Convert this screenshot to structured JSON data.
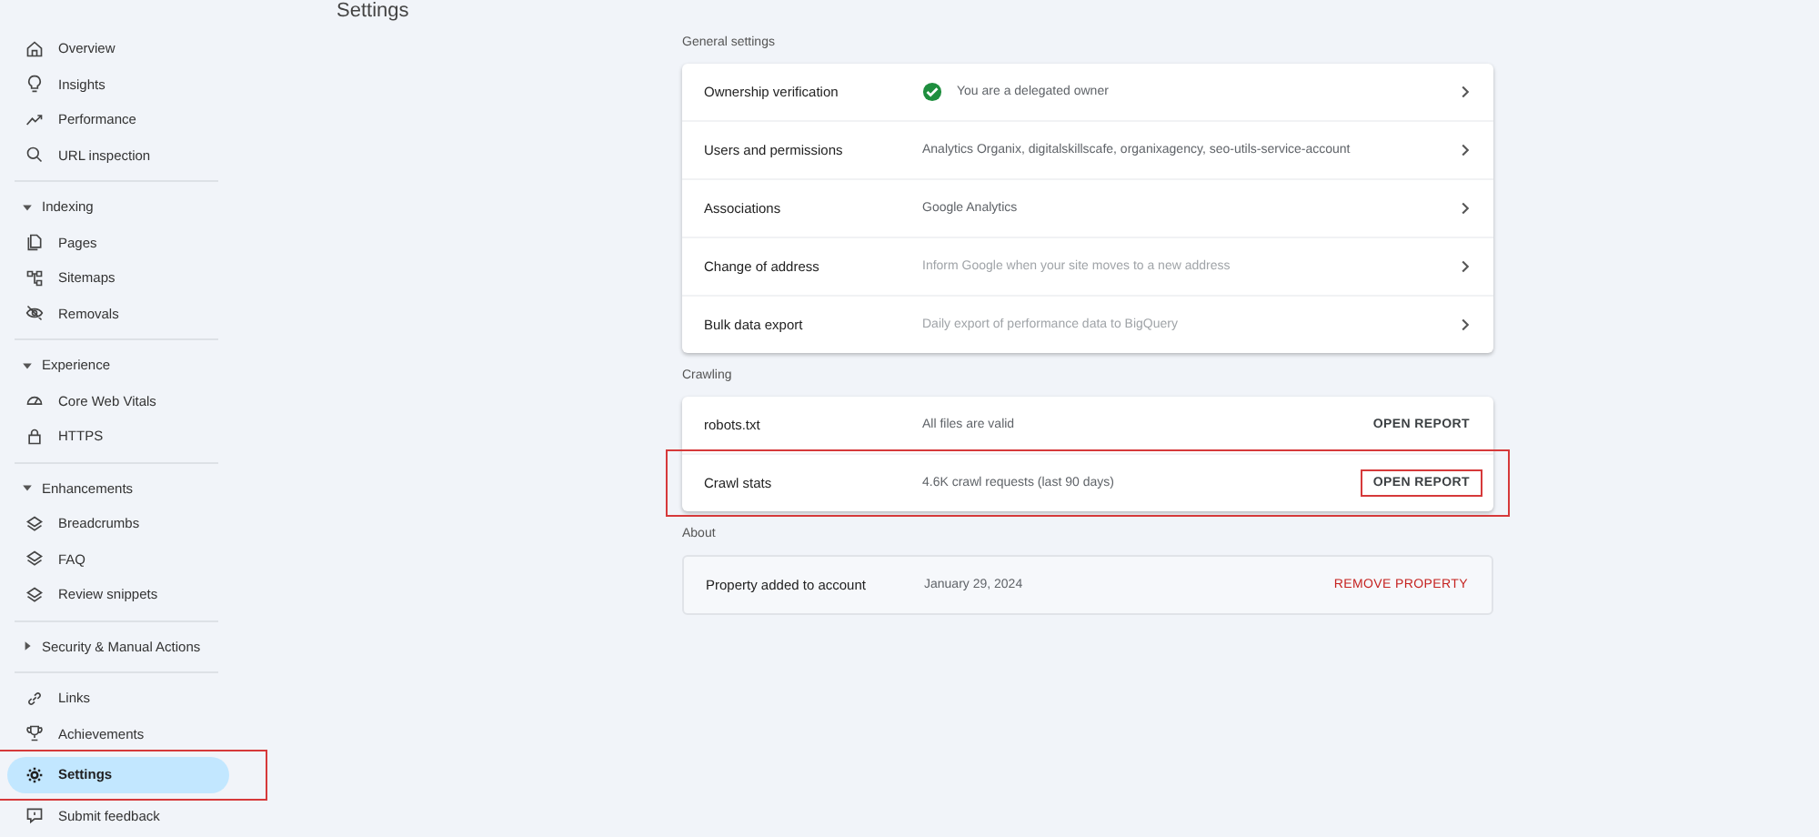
{
  "header": {
    "title": "Settings"
  },
  "sidebar": {
    "groups": [
      {
        "items": [
          {
            "label": "Overview",
            "selected": false,
            "highlighted": false
          },
          {
            "label": "Insights",
            "selected": false,
            "highlighted": false
          },
          {
            "label": "Performance",
            "selected": false,
            "highlighted": false
          },
          {
            "label": "URL inspection",
            "selected": false,
            "highlighted": false
          }
        ]
      },
      {
        "heading": "Indexing",
        "expanded": true,
        "items": [
          {
            "label": "Pages",
            "selected": false,
            "highlighted": false
          },
          {
            "label": "Sitemaps",
            "selected": false,
            "highlighted": false
          },
          {
            "label": "Removals",
            "selected": false,
            "highlighted": false
          }
        ]
      },
      {
        "heading": "Experience",
        "expanded": true,
        "items": [
          {
            "label": "Core Web Vitals",
            "selected": false,
            "highlighted": false
          },
          {
            "label": "HTTPS",
            "selected": false,
            "highlighted": false
          }
        ]
      },
      {
        "heading": "Enhancements",
        "expanded": true,
        "items": [
          {
            "label": "Breadcrumbs",
            "selected": false,
            "highlighted": false
          },
          {
            "label": "FAQ",
            "selected": false,
            "highlighted": false
          },
          {
            "label": "Review snippets",
            "selected": false,
            "highlighted": false
          }
        ]
      },
      {
        "heading": "Security & Manual Actions",
        "expanded": false
      },
      {
        "items": [
          {
            "label": "Links",
            "selected": false,
            "highlighted": false
          },
          {
            "label": "Achievements",
            "selected": false,
            "highlighted": false
          },
          {
            "label": "Settings",
            "selected": true,
            "highlighted": true
          },
          {
            "label": "Submit feedback",
            "selected": false,
            "highlighted": false
          }
        ]
      }
    ]
  },
  "sections": [
    {
      "heading": "General settings",
      "kind": "elevated",
      "rows": [
        {
          "label": "Ownership verification",
          "value": "You are a delegated owner",
          "verified": true,
          "muted": false,
          "highlighted": false,
          "action": {
            "kind": "chevron"
          }
        },
        {
          "label": "Users and permissions",
          "value": "Analytics Organix, digitalskillscafe, organixagency, seo-utils-service-account",
          "verified": false,
          "muted": false,
          "highlighted": false,
          "action": {
            "kind": "chevron"
          }
        },
        {
          "label": "Associations",
          "value": "Google Analytics",
          "verified": false,
          "muted": false,
          "highlighted": false,
          "action": {
            "kind": "chevron"
          }
        },
        {
          "label": "Change of address",
          "value": "Inform Google when your site moves to a new address",
          "verified": false,
          "muted": true,
          "highlighted": false,
          "action": {
            "kind": "chevron"
          }
        },
        {
          "label": "Bulk data export",
          "value": "Daily export of performance data to BigQuery",
          "verified": false,
          "muted": true,
          "highlighted": false,
          "action": {
            "kind": "chevron"
          }
        }
      ]
    },
    {
      "heading": "Crawling",
      "kind": "elevated",
      "rows": [
        {
          "label": "robots.txt",
          "value": "All files are valid",
          "verified": false,
          "muted": false,
          "highlighted": false,
          "action": {
            "kind": "button",
            "label": "OPEN REPORT",
            "highlighted": false
          }
        },
        {
          "label": "Crawl stats",
          "value": "4.6K crawl requests (last 90 days)",
          "verified": false,
          "muted": false,
          "highlighted": true,
          "action": {
            "kind": "button",
            "label": "OPEN REPORT",
            "highlighted": true
          }
        }
      ]
    },
    {
      "heading": "About",
      "kind": "outlined",
      "rows": [
        {
          "label": "Property added to account",
          "value": "January 29, 2024",
          "verified": false,
          "muted": false,
          "highlighted": false,
          "action": {
            "kind": "danger-button",
            "label": "REMOVE PROPERTY",
            "highlighted": false
          }
        }
      ]
    }
  ]
}
